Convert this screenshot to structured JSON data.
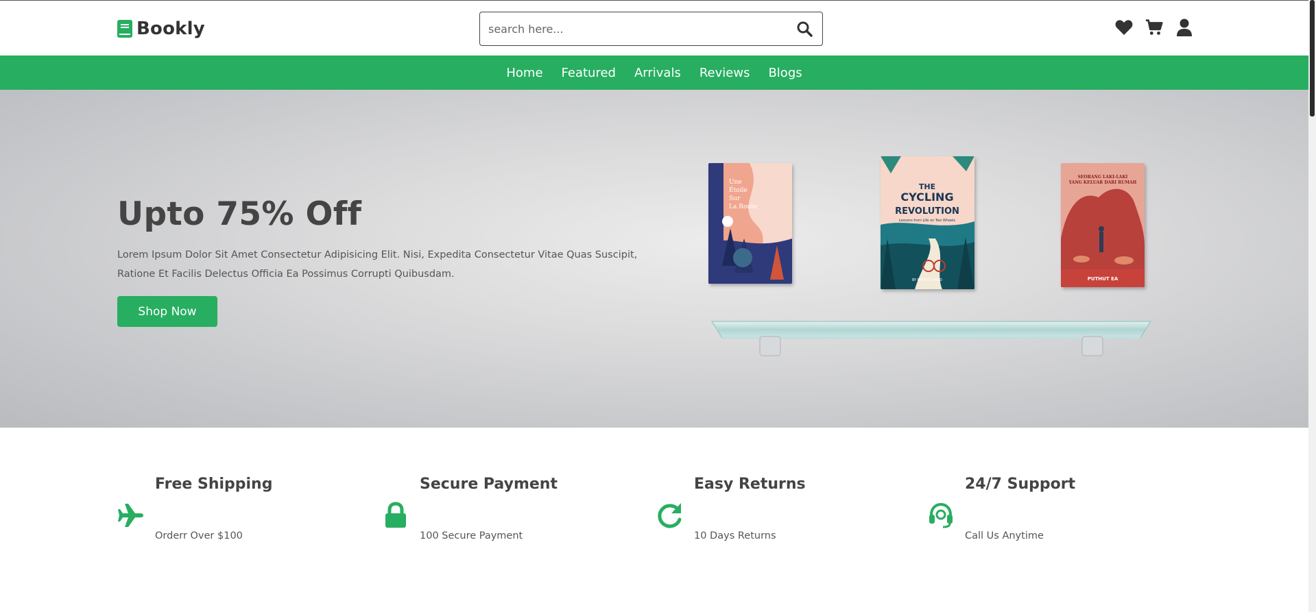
{
  "header": {
    "logo_text": "Bookly",
    "search_placeholder": "search here..."
  },
  "nav": {
    "items": [
      {
        "label": "Home"
      },
      {
        "label": "Featured"
      },
      {
        "label": "Arrivals"
      },
      {
        "label": "Reviews"
      },
      {
        "label": "Blogs"
      }
    ]
  },
  "hero": {
    "title": "Upto 75% Off",
    "description": "Lorem Ipsum Dolor Sit Amet Consectetur Adipisicing Elit. Nisi, Expedita Consectetur Vitae Quas Suscipit, Ratione Et Facilis Delectus Officia Ea Possimus Corrupti Quibusdam.",
    "button_label": "Shop Now",
    "books": [
      {
        "title_lines": [
          "Une",
          "Étoile",
          "Sur",
          "La Route"
        ]
      },
      {
        "title_lines": [
          "THE",
          "CYCLING",
          "REVOLUTION"
        ],
        "subtitle": "Lessons from Life on Two Wheels",
        "author": "BY PATRICK FIELD"
      },
      {
        "title_lines": [
          "SEORANG LAKI-LAKI",
          "YANG KELUAR DARI RUMAH"
        ],
        "author": "PUTHUT EA"
      }
    ]
  },
  "features": [
    {
      "title": "Free Shipping",
      "subtitle": "Orderr Over $100",
      "icon": "plane-icon"
    },
    {
      "title": "Secure Payment",
      "subtitle": "100 Secure Payment",
      "icon": "lock-icon"
    },
    {
      "title": "Easy Returns",
      "subtitle": "10 Days Returns",
      "icon": "redo-icon"
    },
    {
      "title": "24/7 Support",
      "subtitle": "Call Us Anytime",
      "icon": "headset-icon"
    }
  ],
  "colors": {
    "accent": "#27ae60",
    "text_dark": "#444444"
  }
}
